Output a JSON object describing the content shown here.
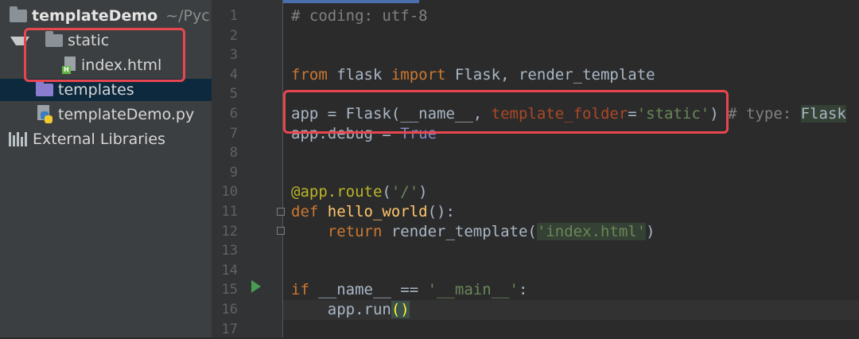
{
  "project_tree": {
    "root": {
      "name": "templateDemo",
      "path_hint": "~/Pyc"
    },
    "items": [
      {
        "label": "static",
        "icon": "folder-icon"
      },
      {
        "label": "index.html",
        "icon": "html-file-icon"
      },
      {
        "label": "templates",
        "icon": "templates-folder-icon"
      },
      {
        "label": "templateDemo.py",
        "icon": "python-file-icon"
      },
      {
        "label": "External Libraries",
        "icon": "libraries-icon"
      }
    ]
  },
  "editor": {
    "line_numbers": [
      "1",
      "2",
      "3",
      "4",
      "5",
      "6",
      "7",
      "8",
      "9",
      "10",
      "11",
      "12",
      "13",
      "14",
      "15",
      "16",
      "17"
    ],
    "lines": {
      "l1": "# coding: utf-8",
      "l4_from": "from",
      "l4_module": " flask ",
      "l4_import": "import",
      "l4_names": " Flask, render_template",
      "l6_app": "app = Flask(__name__, ",
      "l6_param": "template_folder",
      "l6_eq": "=",
      "l6_str": "'static'",
      "l6_close": ")",
      "l6_comment": " # type: ",
      "l6_type": "Flask",
      "l7_code": "app.debug = ",
      "l7_true": "True",
      "l10_deco": "@app.route",
      "l10_open": "(",
      "l10_str": "'/'",
      "l10_close": ")",
      "l11_def": "def",
      "l11_fn": " hello_world",
      "l11_rest": "():",
      "l12_indent": "    ",
      "l12_return": "return",
      "l12_call": " render_template(",
      "l12_str": "'index.html'",
      "l12_close": ")",
      "l15_if": "if",
      "l15_cond": " __name__ == ",
      "l15_str": "'__main__'",
      "l15_colon": ":",
      "l16_code": "    app.run",
      "l16_parens": "()"
    }
  },
  "colors": {
    "keyword": "#cc7832",
    "string": "#6a8759",
    "comment": "#808080",
    "highlight_box": "#e8464f",
    "run_gutter": "#499c54"
  }
}
